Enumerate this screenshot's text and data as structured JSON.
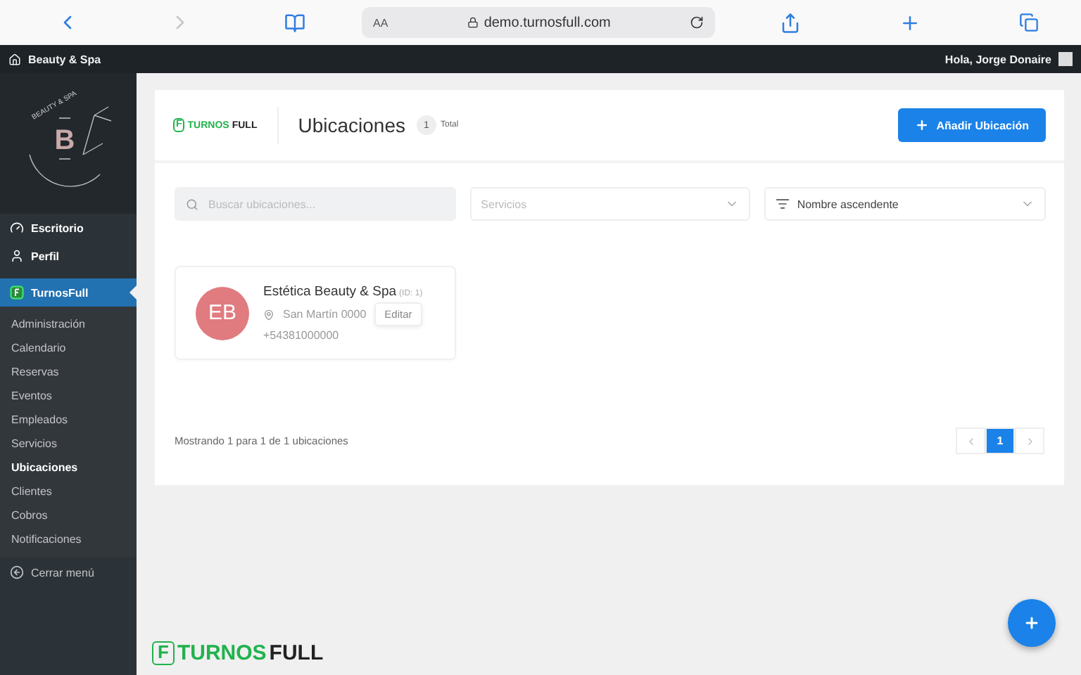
{
  "browser": {
    "text_size": "AA",
    "url": "demo.turnosfull.com"
  },
  "admin_bar": {
    "site": "Beauty & Spa",
    "greeting": "Hola, Jorge Donaire"
  },
  "sidebar": {
    "logo": {
      "letter": "B",
      "tagline": "BEAUTY & SPA"
    },
    "items": [
      {
        "label": "Escritorio",
        "kind": "dashboard",
        "selected": false
      },
      {
        "label": "Perfil",
        "kind": "user",
        "selected": false
      },
      {
        "label": "TurnosFull",
        "kind": "plugin",
        "selected": true
      }
    ],
    "submenu": [
      {
        "label": "Administración",
        "selected": false
      },
      {
        "label": "Calendario",
        "selected": false
      },
      {
        "label": "Reservas",
        "selected": false
      },
      {
        "label": "Eventos",
        "selected": false
      },
      {
        "label": "Empleados",
        "selected": false
      },
      {
        "label": "Servicios",
        "selected": false
      },
      {
        "label": "Ubicaciones",
        "selected": true
      },
      {
        "label": "Clientes",
        "selected": false
      },
      {
        "label": "Cobros",
        "selected": false
      },
      {
        "label": "Notificaciones",
        "selected": false
      }
    ],
    "collapse": "Cerrar menú"
  },
  "header": {
    "brand": {
      "mark": "F",
      "name_a": "TURNOS",
      "name_b": "FULL"
    },
    "title": "Ubicaciones",
    "count": "1",
    "count_label": "Total",
    "add_button": "Añadir Ubicación"
  },
  "filters": {
    "search": {
      "placeholder": "Buscar ubicaciones..."
    },
    "services": {
      "placeholder": "Servicios"
    },
    "sort": {
      "value": "Nombre ascendente"
    }
  },
  "locations": [
    {
      "initials": "EB",
      "color": "#e07b80",
      "name": "Estética Beauty & Spa",
      "id_label": "(ID: 1)",
      "address": "San Martín 0000",
      "phone": "+54381000000",
      "edit": "Editar"
    }
  ],
  "footer": {
    "summary": "Mostrando 1 para 1 de 1 ubicaciones",
    "pages": [
      {
        "label": "1",
        "selected": true
      }
    ]
  },
  "bottom_brand": {
    "mark": "F",
    "name_a": "TURNOS",
    "name_b": "FULL"
  }
}
